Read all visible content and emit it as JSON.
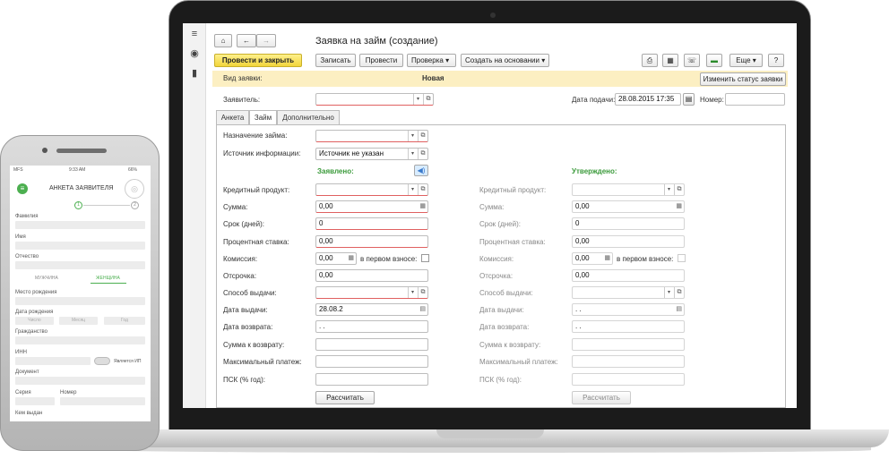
{
  "laptop": {
    "window_title": "Заявка на займ (создание)",
    "toolbar": {
      "post_close": "Провести и закрыть",
      "save": "Записать",
      "post": "Провести",
      "check": "Проверка",
      "create_based": "Создать на основании",
      "more": "Еще",
      "help": "?"
    },
    "status_band": {
      "label": "Вид заявки:",
      "value": "Новая",
      "change_button": "Изменить статус заявки"
    },
    "header": {
      "applicant_label": "Заявитель:",
      "applicant_value": "",
      "date_label": "Дата подачи:",
      "date_value": "28.08.2015 17:35",
      "number_label": "Номер:",
      "number_value": ""
    },
    "tabs": [
      "Анкета",
      "Займ",
      "Дополнительно"
    ],
    "loan": {
      "purpose_label": "Назначение займа:",
      "purpose_value": "",
      "source_label": "Источник информации:",
      "source_value": "Источник не указан",
      "declared_heading": "Заявлено:",
      "approved_heading": "Утверждено:",
      "labels": {
        "product": "Кредитный продукт:",
        "amount": "Сумма:",
        "term": "Срок (дней):",
        "rate": "Процентная ставка:",
        "commission": "Комиссия:",
        "first_payment": "в первом взносе:",
        "deferment": "Отсрочка:",
        "issue_method": "Способ выдачи:",
        "issue_date": "Дата выдачи:",
        "return_date": "Дата возврата:",
        "return_sum": "Сумма к возврату:",
        "max_payment": "Максимальный платеж:",
        "psk": "ПСК (% год):"
      },
      "declared": {
        "amount": "0,00",
        "term": "0",
        "rate": "0,00",
        "commission": "0,00",
        "deferment": "0,00",
        "issue_date": "28.08.2",
        "return_date": " .  ."
      },
      "approved": {
        "amount": "0,00",
        "term": "0",
        "rate": "0,00",
        "commission": "0,00",
        "deferment": "0,00",
        "issue_date": " .  .",
        "return_date": " .  ."
      },
      "calc_button": "Рассчитать"
    }
  },
  "phone": {
    "status_bar": {
      "carrier": "MFS",
      "time": "9:33 AM",
      "battery": "66%"
    },
    "title": "АНКЕТА ЗАЯВИТЕЛЯ",
    "steps": [
      "1",
      "2"
    ],
    "fields": {
      "surname": "Фамилия",
      "name": "Имя",
      "patronymic": "Отчество",
      "gender_male": "МУЖЧИНА",
      "gender_female": "ЖЕНЩИНА",
      "birthplace": "Место рождения",
      "birthdate": "Дата рождения",
      "day": "Число",
      "month": "Месяц",
      "year": "Год",
      "citizenship": "Гражданство",
      "inn": "ИНН",
      "is_ip": "Является ИП",
      "document": "Документ",
      "series": "Серия",
      "number": "Номер",
      "issued_by": "Кем выдан"
    }
  },
  "colors": {
    "accent_yellow": "#f2d53a",
    "green": "#3a9a3a",
    "band": "#fcefc2",
    "phone_green": "#4caf50"
  }
}
